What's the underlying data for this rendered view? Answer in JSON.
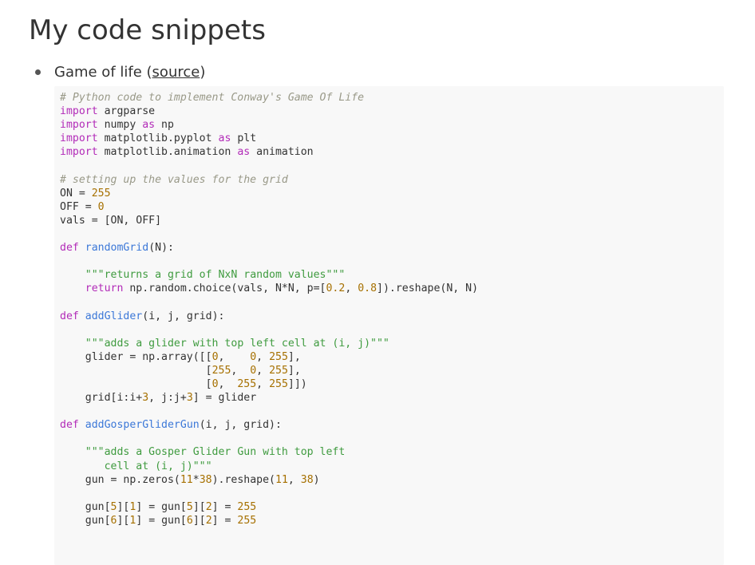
{
  "page": {
    "title": "My code snippets"
  },
  "snippets": [
    {
      "name": "Game of life",
      "paren_open": " (",
      "link_label": "source",
      "paren_close": ")",
      "code_lines": [
        [
          {
            "t": "# Python code to implement Conway's Game Of Life",
            "c": "cmt"
          }
        ],
        [
          {
            "t": "import",
            "c": "kw"
          },
          {
            "t": " argparse"
          }
        ],
        [
          {
            "t": "import",
            "c": "kw"
          },
          {
            "t": " numpy "
          },
          {
            "t": "as",
            "c": "kw"
          },
          {
            "t": " np"
          }
        ],
        [
          {
            "t": "import",
            "c": "kw"
          },
          {
            "t": " matplotlib.pyplot "
          },
          {
            "t": "as",
            "c": "kw"
          },
          {
            "t": " plt"
          }
        ],
        [
          {
            "t": "import",
            "c": "kw"
          },
          {
            "t": " matplotlib.animation "
          },
          {
            "t": "as",
            "c": "kw"
          },
          {
            "t": " animation"
          }
        ],
        [],
        [
          {
            "t": "# setting up the values for the grid",
            "c": "cmt"
          }
        ],
        [
          {
            "t": "ON = "
          },
          {
            "t": "255",
            "c": "num"
          }
        ],
        [
          {
            "t": "OFF = "
          },
          {
            "t": "0",
            "c": "num"
          }
        ],
        [
          {
            "t": "vals = [ON, OFF]"
          }
        ],
        [],
        [
          {
            "t": "def",
            "c": "kw"
          },
          {
            "t": " "
          },
          {
            "t": "randomGrid",
            "c": "fn"
          },
          {
            "t": "(N):"
          }
        ],
        [],
        [
          {
            "t": "    "
          },
          {
            "t": "\"\"\"returns a grid of NxN random values\"\"\"",
            "c": "str"
          }
        ],
        [
          {
            "t": "    "
          },
          {
            "t": "return",
            "c": "kw"
          },
          {
            "t": " np.random.choice(vals, N*N, p=["
          },
          {
            "t": "0.2",
            "c": "num"
          },
          {
            "t": ", "
          },
          {
            "t": "0.8",
            "c": "num"
          },
          {
            "t": "]).reshape(N, N)"
          }
        ],
        [],
        [
          {
            "t": "def",
            "c": "kw"
          },
          {
            "t": " "
          },
          {
            "t": "addGlider",
            "c": "fn"
          },
          {
            "t": "(i, j, grid):"
          }
        ],
        [],
        [
          {
            "t": "    "
          },
          {
            "t": "\"\"\"adds a glider with top left cell at (i, j)\"\"\"",
            "c": "str"
          }
        ],
        [
          {
            "t": "    glider = np.array([["
          },
          {
            "t": "0",
            "c": "num"
          },
          {
            "t": ",    "
          },
          {
            "t": "0",
            "c": "num"
          },
          {
            "t": ", "
          },
          {
            "t": "255",
            "c": "num"
          },
          {
            "t": "],"
          }
        ],
        [
          {
            "t": "                       ["
          },
          {
            "t": "255",
            "c": "num"
          },
          {
            "t": ",  "
          },
          {
            "t": "0",
            "c": "num"
          },
          {
            "t": ", "
          },
          {
            "t": "255",
            "c": "num"
          },
          {
            "t": "],"
          }
        ],
        [
          {
            "t": "                       ["
          },
          {
            "t": "0",
            "c": "num"
          },
          {
            "t": ",  "
          },
          {
            "t": "255",
            "c": "num"
          },
          {
            "t": ", "
          },
          {
            "t": "255",
            "c": "num"
          },
          {
            "t": "]])"
          }
        ],
        [
          {
            "t": "    grid[i:i+"
          },
          {
            "t": "3",
            "c": "num"
          },
          {
            "t": ", j:j+"
          },
          {
            "t": "3",
            "c": "num"
          },
          {
            "t": "] = glider"
          }
        ],
        [],
        [
          {
            "t": "def",
            "c": "kw"
          },
          {
            "t": " "
          },
          {
            "t": "addGosperGliderGun",
            "c": "fn"
          },
          {
            "t": "(i, j, grid):"
          }
        ],
        [],
        [
          {
            "t": "    "
          },
          {
            "t": "\"\"\"adds a Gosper Glider Gun with top left",
            "c": "str"
          }
        ],
        [
          {
            "t": "       cell at (i, j)\"\"\"",
            "c": "str"
          }
        ],
        [
          {
            "t": "    gun = np.zeros("
          },
          {
            "t": "11",
            "c": "num"
          },
          {
            "t": "*"
          },
          {
            "t": "38",
            "c": "num"
          },
          {
            "t": ").reshape("
          },
          {
            "t": "11",
            "c": "num"
          },
          {
            "t": ", "
          },
          {
            "t": "38",
            "c": "num"
          },
          {
            "t": ")"
          }
        ],
        [],
        [
          {
            "t": "    gun["
          },
          {
            "t": "5",
            "c": "num"
          },
          {
            "t": "]["
          },
          {
            "t": "1",
            "c": "num"
          },
          {
            "t": "] = gun["
          },
          {
            "t": "5",
            "c": "num"
          },
          {
            "t": "]["
          },
          {
            "t": "2",
            "c": "num"
          },
          {
            "t": "] = "
          },
          {
            "t": "255",
            "c": "num"
          }
        ],
        [
          {
            "t": "    gun["
          },
          {
            "t": "6",
            "c": "num"
          },
          {
            "t": "]["
          },
          {
            "t": "1",
            "c": "num"
          },
          {
            "t": "] = gun["
          },
          {
            "t": "6",
            "c": "num"
          },
          {
            "t": "]["
          },
          {
            "t": "2",
            "c": "num"
          },
          {
            "t": "] = "
          },
          {
            "t": "255",
            "c": "num"
          }
        ]
      ]
    }
  ],
  "colors": {
    "comment": "#999988",
    "keyword": "#b22bb8",
    "function": "#3c78d8",
    "number": "#a67000",
    "string": "#3f9b3f",
    "code_background": "#f8f8f8"
  }
}
